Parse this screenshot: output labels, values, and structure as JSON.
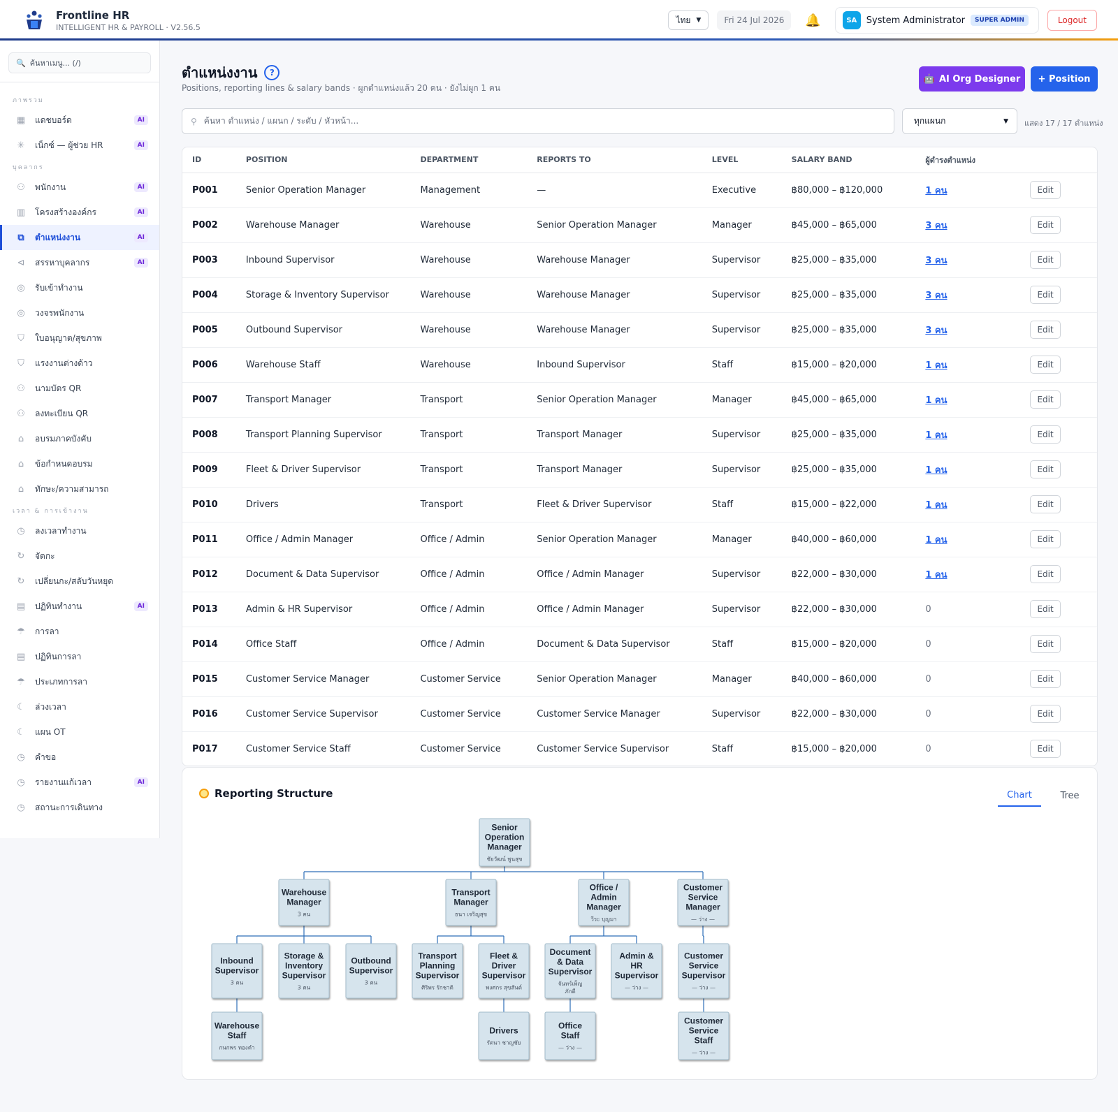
{
  "app": {
    "name": "Frontline HR",
    "subtitle": "INTELLIGENT HR & PAYROLL · V2.56.5"
  },
  "header": {
    "language": "ไทย",
    "date": "Fri 24 Jul 2026",
    "user_initials": "SA",
    "user_name": "System Administrator",
    "user_role": "SUPER ADMIN",
    "logout_label": "Logout"
  },
  "sidebar": {
    "search_placeholder": "ค้นหาเมนู... (/)",
    "sections": [
      {
        "title": "ภาพรวม",
        "items": [
          {
            "label": "แดชบอร์ด",
            "icon": "grid-icon",
            "ai": true,
            "active": false
          },
          {
            "label": "เน็กซ์ — ผู้ช่วย HR",
            "icon": "sparkle-icon",
            "ai": true,
            "active": false
          }
        ]
      },
      {
        "title": "บุคลากร",
        "items": [
          {
            "label": "พนักงาน",
            "icon": "users-icon",
            "ai": true,
            "active": false
          },
          {
            "label": "โครงสร้างองค์กร",
            "icon": "building-icon",
            "ai": true,
            "active": false
          },
          {
            "label": "ตำแหน่งงาน",
            "icon": "org-icon",
            "ai": true,
            "active": true
          },
          {
            "label": "สรรหาบุคลากร",
            "icon": "megaphone-icon",
            "ai": true,
            "active": false
          },
          {
            "label": "รับเข้าทำงาน",
            "icon": "compass-icon",
            "ai": false,
            "active": false
          },
          {
            "label": "วงจรพนักงาน",
            "icon": "compass-icon",
            "ai": false,
            "active": false
          },
          {
            "label": "ใบอนุญาต/สุขภาพ",
            "icon": "shield-icon",
            "ai": false,
            "active": false
          },
          {
            "label": "แรงงานต่างด้าว",
            "icon": "shield-icon",
            "ai": false,
            "active": false
          },
          {
            "label": "นามบัตร QR",
            "icon": "users-icon",
            "ai": false,
            "active": false
          },
          {
            "label": "ลงทะเบียน QR",
            "icon": "users-icon",
            "ai": false,
            "active": false
          },
          {
            "label": "อบรมภาคบังคับ",
            "icon": "graduation-icon",
            "ai": false,
            "active": false
          },
          {
            "label": "ข้อกำหนดอบรม",
            "icon": "graduation-icon",
            "ai": false,
            "active": false
          },
          {
            "label": "ทักษะ/ความสามารถ",
            "icon": "graduation-icon",
            "ai": false,
            "active": false
          }
        ]
      },
      {
        "title": "เวลา & การเข้างาน",
        "items": [
          {
            "label": "ลงเวลาทำงาน",
            "icon": "clock-icon",
            "ai": false,
            "active": false
          },
          {
            "label": "จัดกะ",
            "icon": "refresh-icon",
            "ai": false,
            "active": false
          },
          {
            "label": "เปลี่ยนกะ/สลับวันหยุด",
            "icon": "refresh-icon",
            "ai": false,
            "active": false
          },
          {
            "label": "ปฏิทินทำงาน",
            "icon": "calendar-icon",
            "ai": true,
            "active": false
          },
          {
            "label": "การลา",
            "icon": "umbrella-icon",
            "ai": false,
            "active": false
          },
          {
            "label": "ปฏิทินการลา",
            "icon": "calendar-icon",
            "ai": false,
            "active": false
          },
          {
            "label": "ประเภทการลา",
            "icon": "umbrella-icon",
            "ai": false,
            "active": false
          },
          {
            "label": "ล่วงเวลา",
            "icon": "moon-icon",
            "ai": false,
            "active": false
          },
          {
            "label": "แผน OT",
            "icon": "moon-icon",
            "ai": false,
            "active": false
          },
          {
            "label": "คำขอ",
            "icon": "clock-icon",
            "ai": false,
            "active": false
          },
          {
            "label": "รายงานแก้เวลา",
            "icon": "clock-icon",
            "ai": true,
            "active": false
          },
          {
            "label": "สถานะการเดินทาง",
            "icon": "clock-icon",
            "ai": false,
            "active": false
          }
        ]
      }
    ]
  },
  "page": {
    "title": "ตำแหน่งงาน",
    "subtitle": "Positions, reporting lines & salary bands · ผูกตำแหน่งแล้ว 20 คน · ยังไม่ผูก 1 คน",
    "ai_button": "AI Org Designer",
    "add_button": "+ Position",
    "search_placeholder": "ค้นหา ตำแหน่ง / แผนก / ระดับ / หัวหน้า...",
    "dept_filter": "ทุกแผนก",
    "count_text": "แสดง 17 / 17 ตำแหน่ง"
  },
  "table": {
    "headers": [
      "ID",
      "POSITION",
      "DEPARTMENT",
      "REPORTS TO",
      "LEVEL",
      "SALARY BAND",
      "ผู้ดำรงตำแหน่ง",
      ""
    ],
    "edit_label": "Edit",
    "rows": [
      {
        "id": "P001",
        "position": "Senior Operation Manager",
        "department": "Management",
        "reports_to": "—",
        "level": "Executive",
        "salary": "฿80,000 – ฿120,000",
        "holders": "1 คน"
      },
      {
        "id": "P002",
        "position": "Warehouse Manager",
        "department": "Warehouse",
        "reports_to": "Senior Operation Manager",
        "level": "Manager",
        "salary": "฿45,000 – ฿65,000",
        "holders": "3 คน"
      },
      {
        "id": "P003",
        "position": "Inbound Supervisor",
        "department": "Warehouse",
        "reports_to": "Warehouse Manager",
        "level": "Supervisor",
        "salary": "฿25,000 – ฿35,000",
        "holders": "3 คน"
      },
      {
        "id": "P004",
        "position": "Storage & Inventory Supervisor",
        "department": "Warehouse",
        "reports_to": "Warehouse Manager",
        "level": "Supervisor",
        "salary": "฿25,000 – ฿35,000",
        "holders": "3 คน"
      },
      {
        "id": "P005",
        "position": "Outbound Supervisor",
        "department": "Warehouse",
        "reports_to": "Warehouse Manager",
        "level": "Supervisor",
        "salary": "฿25,000 – ฿35,000",
        "holders": "3 คน"
      },
      {
        "id": "P006",
        "position": "Warehouse Staff",
        "department": "Warehouse",
        "reports_to": "Inbound Supervisor",
        "level": "Staff",
        "salary": "฿15,000 – ฿20,000",
        "holders": "1 คน"
      },
      {
        "id": "P007",
        "position": "Transport Manager",
        "department": "Transport",
        "reports_to": "Senior Operation Manager",
        "level": "Manager",
        "salary": "฿45,000 – ฿65,000",
        "holders": "1 คน"
      },
      {
        "id": "P008",
        "position": "Transport Planning Supervisor",
        "department": "Transport",
        "reports_to": "Transport Manager",
        "level": "Supervisor",
        "salary": "฿25,000 – ฿35,000",
        "holders": "1 คน"
      },
      {
        "id": "P009",
        "position": "Fleet & Driver Supervisor",
        "department": "Transport",
        "reports_to": "Transport Manager",
        "level": "Supervisor",
        "salary": "฿25,000 – ฿35,000",
        "holders": "1 คน"
      },
      {
        "id": "P010",
        "position": "Drivers",
        "department": "Transport",
        "reports_to": "Fleet & Driver Supervisor",
        "level": "Staff",
        "salary": "฿15,000 – ฿22,000",
        "holders": "1 คน"
      },
      {
        "id": "P011",
        "position": "Office / Admin Manager",
        "department": "Office / Admin",
        "reports_to": "Senior Operation Manager",
        "level": "Manager",
        "salary": "฿40,000 – ฿60,000",
        "holders": "1 คน"
      },
      {
        "id": "P012",
        "position": "Document & Data Supervisor",
        "department": "Office / Admin",
        "reports_to": "Office / Admin Manager",
        "level": "Supervisor",
        "salary": "฿22,000 – ฿30,000",
        "holders": "1 คน"
      },
      {
        "id": "P013",
        "position": "Admin & HR Supervisor",
        "department": "Office / Admin",
        "reports_to": "Office / Admin Manager",
        "level": "Supervisor",
        "salary": "฿22,000 – ฿30,000",
        "holders": "0"
      },
      {
        "id": "P014",
        "position": "Office Staff",
        "department": "Office / Admin",
        "reports_to": "Document & Data Supervisor",
        "level": "Staff",
        "salary": "฿15,000 – ฿20,000",
        "holders": "0"
      },
      {
        "id": "P015",
        "position": "Customer Service Manager",
        "department": "Customer Service",
        "reports_to": "Senior Operation Manager",
        "level": "Manager",
        "salary": "฿40,000 – ฿60,000",
        "holders": "0"
      },
      {
        "id": "P016",
        "position": "Customer Service Supervisor",
        "department": "Customer Service",
        "reports_to": "Customer Service Manager",
        "level": "Supervisor",
        "salary": "฿22,000 – ฿30,000",
        "holders": "0"
      },
      {
        "id": "P017",
        "position": "Customer Service Staff",
        "department": "Customer Service",
        "reports_to": "Customer Service Supervisor",
        "level": "Staff",
        "salary": "฿15,000 – ฿20,000",
        "holders": "0"
      }
    ]
  },
  "org": {
    "title": "Reporting Structure",
    "tab_chart": "Chart",
    "tab_tree": "Tree",
    "nodes": [
      {
        "key": "sr",
        "title": [
          "Senior",
          "Operation",
          "Manager"
        ],
        "sub": [
          "ชัยวัฒน์ พูนสุข"
        ],
        "parent": null
      },
      {
        "key": "wm",
        "title": [
          "Warehouse",
          "Manager"
        ],
        "sub": [
          "3 คน"
        ],
        "parent": "sr"
      },
      {
        "key": "tm",
        "title": [
          "Transport",
          "Manager"
        ],
        "sub": [
          "ธนา เจริญสุข"
        ],
        "parent": "sr"
      },
      {
        "key": "om",
        "title": [
          "Office /",
          "Admin",
          "Manager"
        ],
        "sub": [
          "วีระ บุญมา"
        ],
        "parent": "sr"
      },
      {
        "key": "cm",
        "title": [
          "Customer",
          "Service",
          "Manager"
        ],
        "sub": [
          "— ว่าง —"
        ],
        "parent": "sr"
      },
      {
        "key": "is",
        "title": [
          "Inbound",
          "Supervisor"
        ],
        "sub": [
          "3 คน"
        ],
        "parent": "wm"
      },
      {
        "key": "ss",
        "title": [
          "Storage &",
          "Inventory",
          "Supervisor"
        ],
        "sub": [
          "3 คน"
        ],
        "parent": "wm"
      },
      {
        "key": "os",
        "title": [
          "Outbound",
          "Supervisor"
        ],
        "sub": [
          "3 คน"
        ],
        "parent": "wm"
      },
      {
        "key": "tp",
        "title": [
          "Transport",
          "Planning",
          "Supervisor"
        ],
        "sub": [
          "ศิริพร รักชาติ"
        ],
        "parent": "tm"
      },
      {
        "key": "fd",
        "title": [
          "Fleet &",
          "Driver",
          "Supervisor"
        ],
        "sub": [
          "พงศกร สุขสันต์"
        ],
        "parent": "tm"
      },
      {
        "key": "dd",
        "title": [
          "Document",
          "& Data",
          "Supervisor"
        ],
        "sub": [
          "จันทร์เพ็ญ",
          "ภักดี"
        ],
        "parent": "om"
      },
      {
        "key": "ah",
        "title": [
          "Admin &",
          "HR",
          "Supervisor"
        ],
        "sub": [
          "— ว่าง —"
        ],
        "parent": "om"
      },
      {
        "key": "cs",
        "title": [
          "Customer",
          "Service",
          "Supervisor"
        ],
        "sub": [
          "— ว่าง —"
        ],
        "parent": "cm"
      },
      {
        "key": "ws",
        "title": [
          "Warehouse",
          "Staff"
        ],
        "sub": [
          "กนกพร ทองคำ"
        ],
        "parent": "is"
      },
      {
        "key": "dr",
        "title": [
          "Drivers"
        ],
        "sub": [
          "รัตนา ชาญชัย"
        ],
        "parent": "fd"
      },
      {
        "key": "ofs",
        "title": [
          "Office",
          "Staff"
        ],
        "sub": [
          "— ว่าง —"
        ],
        "parent": "dd"
      },
      {
        "key": "cst",
        "title": [
          "Customer",
          "Service",
          "Staff"
        ],
        "sub": [
          "— ว่าง —"
        ],
        "parent": "cs"
      }
    ]
  }
}
